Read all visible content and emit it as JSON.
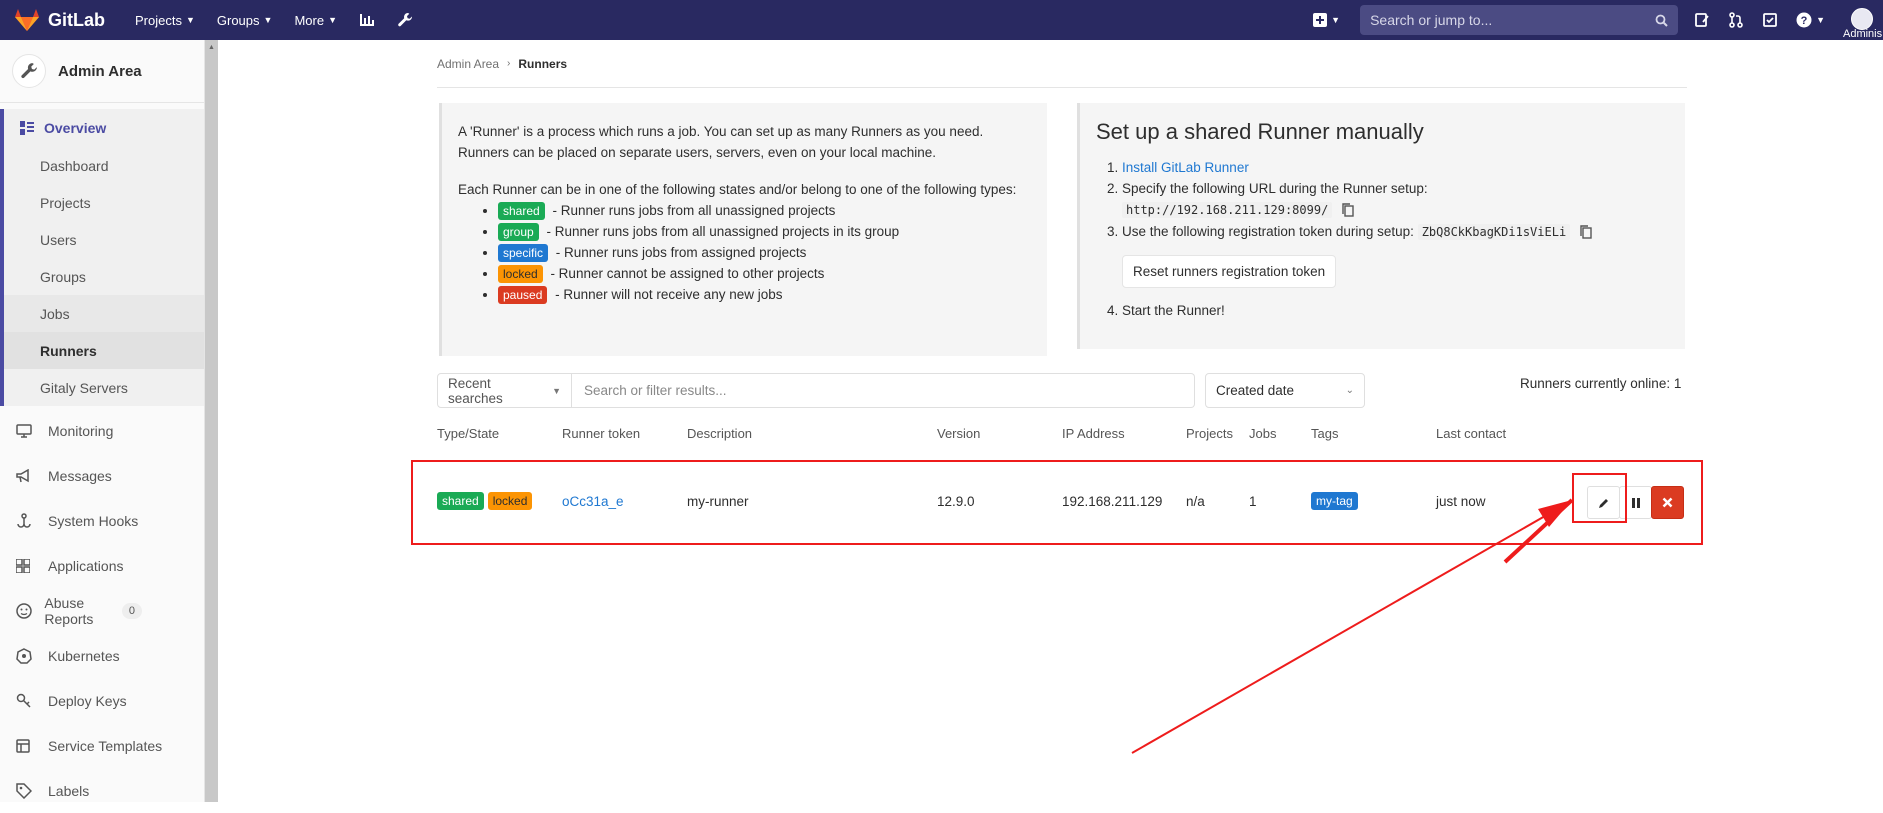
{
  "nav": {
    "brand": "GitLab",
    "projects": "Projects",
    "groups": "Groups",
    "more": "More",
    "search_placeholder": "Search or jump to...",
    "user": "Adminis",
    "chart_icon": "chart-icon",
    "wrench_icon": "wrench-icon"
  },
  "sidebar": {
    "title": "Admin Area",
    "overview": "Overview",
    "sub_items": [
      "Dashboard",
      "Projects",
      "Users",
      "Groups",
      "Jobs",
      "Runners",
      "Gitaly Servers"
    ],
    "items": [
      {
        "label": "Monitoring",
        "icon": "monitor-icon"
      },
      {
        "label": "Messages",
        "icon": "megaphone-icon"
      },
      {
        "label": "System Hooks",
        "icon": "hook-icon"
      },
      {
        "label": "Applications",
        "icon": "grid-icon"
      },
      {
        "label": "Abuse Reports",
        "icon": "smiley-icon",
        "badge": "0"
      },
      {
        "label": "Kubernetes",
        "icon": "kubernetes-icon"
      },
      {
        "label": "Deploy Keys",
        "icon": "key-icon"
      },
      {
        "label": "Service Templates",
        "icon": "template-icon"
      },
      {
        "label": "Labels",
        "icon": "label-icon"
      }
    ]
  },
  "breadcrumb": {
    "parent": "Admin Area",
    "current": "Runners"
  },
  "info": {
    "p1": "A 'Runner' is a process which runs a job. You can set up as many Runners as you need. Runners can be placed on separate users, servers, even on your local machine.",
    "p2": "Each Runner can be in one of the following states and/or belong to one of the following types:",
    "types": [
      {
        "badge": "shared",
        "text": " - Runner runs jobs from all unassigned projects",
        "color": "#1aaa55"
      },
      {
        "badge": "group",
        "text": " - Runner runs jobs from all unassigned projects in its group",
        "color": "#1aaa55"
      },
      {
        "badge": "specific",
        "text": " - Runner runs jobs from assigned projects",
        "color": "#1f78d1"
      },
      {
        "badge": "locked",
        "text": " - Runner cannot be assigned to other projects",
        "color": "#fc9403"
      },
      {
        "badge": "paused",
        "text": " - Runner will not receive any new jobs",
        "color": "#db3b21"
      }
    ]
  },
  "setup": {
    "title": "Set up a shared Runner manually",
    "step1_link": "Install GitLab Runner",
    "step2": "Specify the following URL during the Runner setup:",
    "url": "http://192.168.211.129:8099/",
    "step3": "Use the following registration token during setup:",
    "token": "ZbQ8CkKbagKDi1sViELi",
    "reset_button": "Reset runners registration token",
    "step4": "Start the Runner!"
  },
  "filter": {
    "recent": "Recent searches",
    "placeholder": "Search or filter results...",
    "sort": "Created date",
    "online": "Runners currently online: 1"
  },
  "table": {
    "headers": [
      "Type/State",
      "Runner token",
      "Description",
      "Version",
      "IP Address",
      "Projects",
      "Jobs",
      "Tags",
      "Last contact"
    ],
    "rows": [
      {
        "badges": [
          "shared",
          "locked"
        ],
        "token": "oCc31a_e",
        "description": "my-runner",
        "version": "12.9.0",
        "ip": "192.168.211.129",
        "projects": "n/a",
        "jobs": "1",
        "tag": "my-tag",
        "last_contact": "just now"
      }
    ]
  },
  "colors": {
    "navbar": "#292961",
    "accent": "#4b4ba3",
    "annotation": "#ee1c1c"
  }
}
